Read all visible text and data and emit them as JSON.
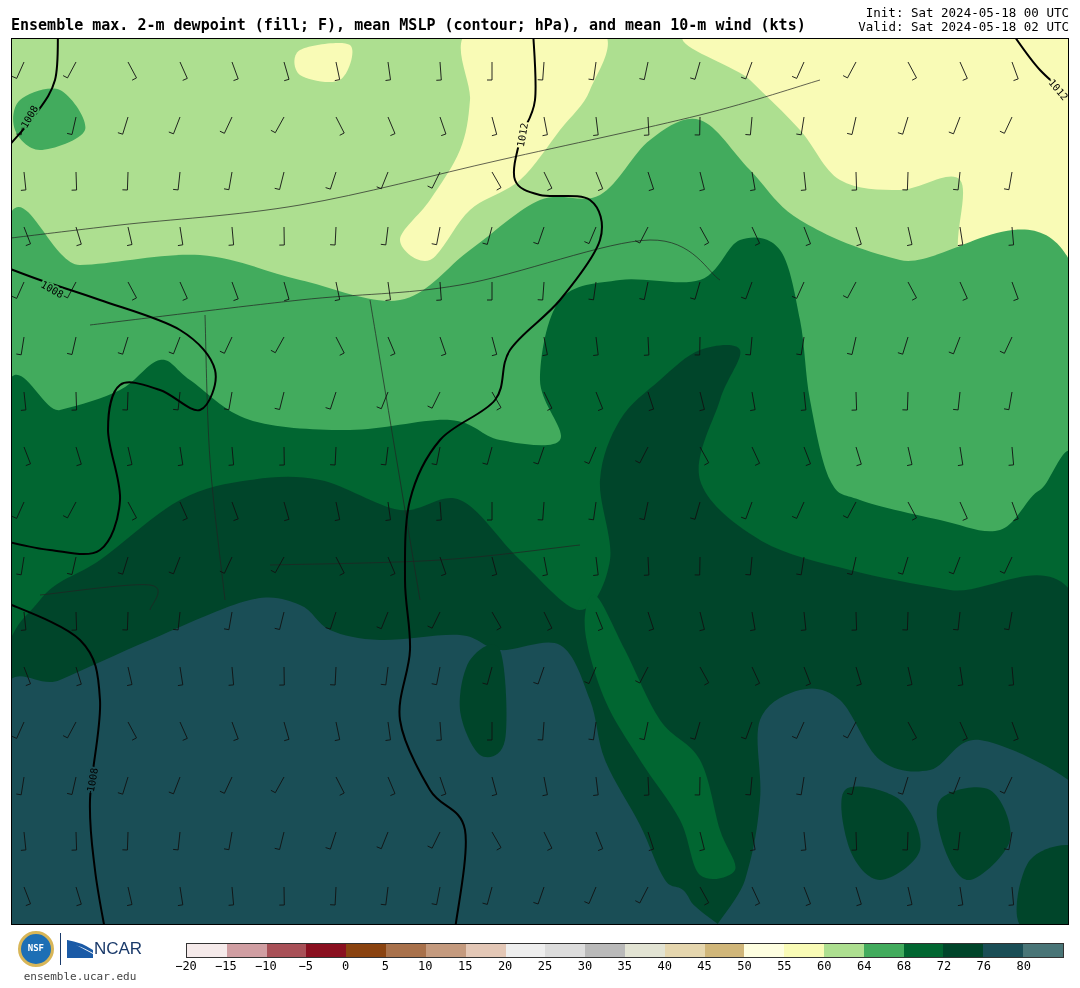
{
  "header": {
    "title": "Ensemble max. 2-m dewpoint (fill; F), mean MSLP (contour; hPa), and mean 10-m wind (kts)",
    "init": "Init: Sat 2024-05-18 00 UTC",
    "valid": "Valid: Sat 2024-05-18 02 UTC"
  },
  "map": {
    "contour_labels": [
      {
        "text": "1008"
      },
      {
        "text": "1008"
      },
      {
        "text": "1008"
      },
      {
        "text": "1012"
      },
      {
        "text": "1012"
      }
    ]
  },
  "footer": {
    "logos": [
      {
        "text": "NSF"
      },
      {
        "text": "NCAR"
      }
    ],
    "site": "ensemble.ucar.edu"
  },
  "colorbar": {
    "bins": [
      {
        "color": "#f5eaea"
      },
      {
        "color": "#d09ea2"
      },
      {
        "color": "#a85057"
      },
      {
        "color": "#8a1020"
      },
      {
        "color": "#8a4310"
      },
      {
        "color": "#a8714b"
      },
      {
        "color": "#c49a7e"
      },
      {
        "color": "#e3c7b6"
      },
      {
        "color": "#eeeeee"
      },
      {
        "color": "#dcdcdc"
      },
      {
        "color": "#b9b9b9"
      },
      {
        "color": "#e2e3d3"
      },
      {
        "color": "#e5d6ae"
      },
      {
        "color": "#d0b679"
      },
      {
        "color": "#fefee0"
      },
      {
        "color": "#f9fbb6"
      },
      {
        "color": "#addf90"
      },
      {
        "color": "#42ab5d"
      },
      {
        "color": "#016631"
      },
      {
        "color": "#00452a"
      },
      {
        "color": "#1a4e56"
      },
      {
        "color": "#497577"
      }
    ],
    "tick_labels": [
      "−20",
      "−15",
      "−10",
      "−5",
      "0",
      "5",
      "10",
      "15",
      "20",
      "25",
      "30",
      "35",
      "40",
      "45",
      "50",
      "55",
      "60",
      "64",
      "68",
      "72",
      "76",
      "80"
    ]
  }
}
